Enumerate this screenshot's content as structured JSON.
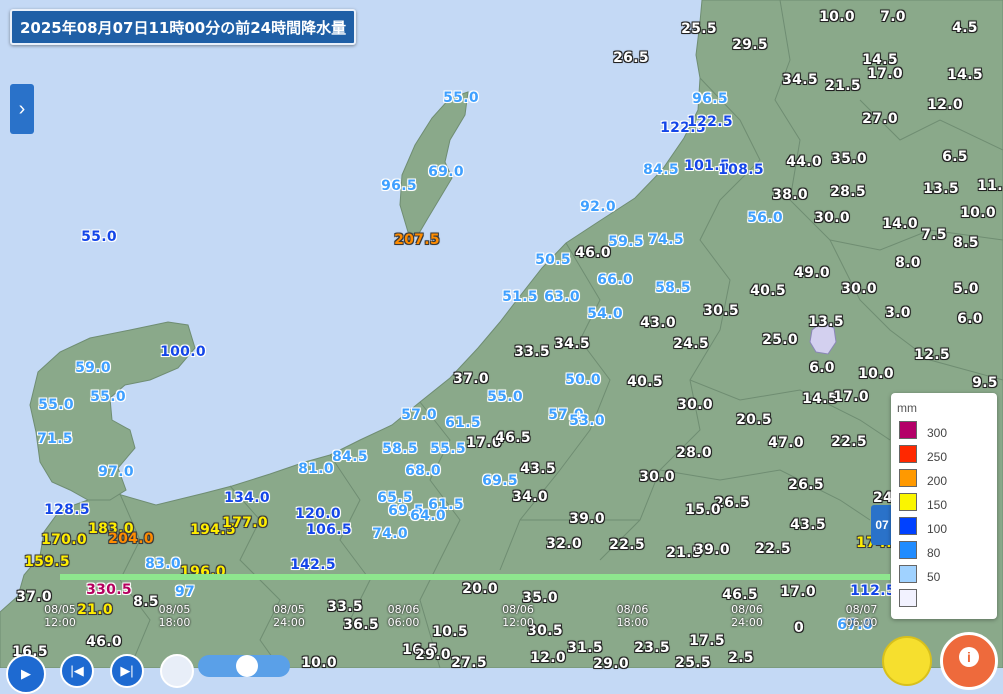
{
  "title": "2025年08月07日11時00分の前24時間降水量",
  "colors": {
    "sea": "#c4d9f5",
    "land": "#8aa98a",
    "border": "#6f8d72",
    "lake": "#d3d0ef",
    "timeline": "#8ee68e"
  },
  "style_colors": {
    "white": "#ffffff",
    "light_blue": "#3fa0ff",
    "blue": "#1446e8",
    "yellow": "#ffee00",
    "orange": "#ff8c00",
    "magenta": "#b5005e"
  },
  "icons": {
    "side_toggle": "chevron-right-icon",
    "help": "help-person-icon",
    "info": "info-book-icon"
  },
  "legend": {
    "unit": "mm",
    "items": [
      {
        "label": "300",
        "color": "#b40068"
      },
      {
        "label": "250",
        "color": "#ff2800"
      },
      {
        "label": "200",
        "color": "#ff9900"
      },
      {
        "label": "150",
        "color": "#faf500"
      },
      {
        "label": "100",
        "color": "#0041ff"
      },
      {
        "label": "80",
        "color": "#218cff"
      },
      {
        "label": "50",
        "color": "#a0d2ff"
      },
      {
        "label": "",
        "color": "#f2f2ff"
      }
    ]
  },
  "timeline": {
    "ticks": [
      {
        "date": "08/05",
        "time": "12:00"
      },
      {
        "date": "08/05",
        "time": "18:00"
      },
      {
        "date": "08/05",
        "time": "24:00"
      },
      {
        "date": "08/06",
        "time": "06:00"
      },
      {
        "date": "08/06",
        "time": "12:00"
      },
      {
        "date": "08/06",
        "time": "18:00"
      },
      {
        "date": "08/06",
        "time": "24:00"
      },
      {
        "date": "08/07",
        "time": "06:00"
      }
    ],
    "current_label": "07"
  },
  "stations": [
    {
      "v": "10.0",
      "s": "white"
    },
    {
      "v": "7.0",
      "s": "white"
    },
    {
      "v": "4.5",
      "s": "white"
    },
    {
      "v": "25.5",
      "s": "white"
    },
    {
      "v": "29.5",
      "s": "white"
    },
    {
      "v": "26.5",
      "s": "white"
    },
    {
      "v": "14.5",
      "s": "white"
    },
    {
      "v": "17.0",
      "s": "white"
    },
    {
      "v": "14.5",
      "s": "white"
    },
    {
      "v": "34.5",
      "s": "white"
    },
    {
      "v": "21.5",
      "s": "white"
    },
    {
      "v": "12.0",
      "s": "white"
    },
    {
      "v": "55.0",
      "s": "light_blue"
    },
    {
      "v": "96.5",
      "s": "light_blue"
    },
    {
      "v": "122.5",
      "s": "blue"
    },
    {
      "v": "122.5",
      "s": "blue"
    },
    {
      "v": "27.0",
      "s": "white"
    },
    {
      "v": "69.0",
      "s": "light_blue"
    },
    {
      "v": "96.5",
      "s": "light_blue"
    },
    {
      "v": "84.5",
      "s": "light_blue"
    },
    {
      "v": "101.5",
      "s": "blue"
    },
    {
      "v": "108.5",
      "s": "blue"
    },
    {
      "v": "44.0",
      "s": "white"
    },
    {
      "v": "35.0",
      "s": "white"
    },
    {
      "v": "6.5",
      "s": "white"
    },
    {
      "v": "38.0",
      "s": "white"
    },
    {
      "v": "28.5",
      "s": "white"
    },
    {
      "v": "13.5",
      "s": "white"
    },
    {
      "v": "92.0",
      "s": "light_blue"
    },
    {
      "v": "10.0",
      "s": "white"
    },
    {
      "v": "55.0",
      "s": "blue"
    },
    {
      "v": "207.5",
      "s": "orange"
    },
    {
      "v": "56.0",
      "s": "light_blue"
    },
    {
      "v": "30.0",
      "s": "white"
    },
    {
      "v": "14.0",
      "s": "white"
    },
    {
      "v": "7.5",
      "s": "white"
    },
    {
      "v": "8.5",
      "s": "white"
    },
    {
      "v": "59.5",
      "s": "light_blue"
    },
    {
      "v": "74.5",
      "s": "light_blue"
    },
    {
      "v": "46.0",
      "s": "white"
    },
    {
      "v": "50.5",
      "s": "light_blue"
    },
    {
      "v": "49.0",
      "s": "white"
    },
    {
      "v": "8.0",
      "s": "white"
    },
    {
      "v": "66.0",
      "s": "light_blue"
    },
    {
      "v": "58.5",
      "s": "light_blue"
    },
    {
      "v": "40.5",
      "s": "white"
    },
    {
      "v": "30.0",
      "s": "white"
    },
    {
      "v": "5.0",
      "s": "white"
    },
    {
      "v": "51.5",
      "s": "light_blue"
    },
    {
      "v": "63.0",
      "s": "light_blue"
    },
    {
      "v": "54.0",
      "s": "light_blue"
    },
    {
      "v": "30.5",
      "s": "white"
    },
    {
      "v": "3.0",
      "s": "white"
    },
    {
      "v": "43.0",
      "s": "white"
    },
    {
      "v": "13.5",
      "s": "white"
    },
    {
      "v": "6.0",
      "s": "white"
    },
    {
      "v": "100.0",
      "s": "blue"
    },
    {
      "v": "33.5",
      "s": "white"
    },
    {
      "v": "34.5",
      "s": "white"
    },
    {
      "v": "24.5",
      "s": "white"
    },
    {
      "v": "25.0",
      "s": "white"
    },
    {
      "v": "12.5",
      "s": "white"
    },
    {
      "v": "59.0",
      "s": "light_blue"
    },
    {
      "v": "37.0",
      "s": "white"
    },
    {
      "v": "50.0",
      "s": "light_blue"
    },
    {
      "v": "40.5",
      "s": "white"
    },
    {
      "v": "6.0",
      "s": "white"
    },
    {
      "v": "10.0",
      "s": "white"
    },
    {
      "v": "9.5",
      "s": "white"
    },
    {
      "v": "55.0",
      "s": "light_blue"
    },
    {
      "v": "55.0",
      "s": "light_blue"
    },
    {
      "v": "55.0",
      "s": "light_blue"
    },
    {
      "v": "14.5",
      "s": "white"
    },
    {
      "v": "17.0",
      "s": "white"
    },
    {
      "v": "30.0",
      "s": "white"
    },
    {
      "v": "57.0",
      "s": "light_blue"
    },
    {
      "v": "61.5",
      "s": "light_blue"
    },
    {
      "v": "57.0",
      "s": "light_blue"
    },
    {
      "v": "53.0",
      "s": "light_blue"
    },
    {
      "v": "20.5",
      "s": "white"
    },
    {
      "v": "71.5",
      "s": "light_blue"
    },
    {
      "v": "58.5",
      "s": "light_blue"
    },
    {
      "v": "55.5",
      "s": "light_blue"
    },
    {
      "v": "17.0",
      "s": "white"
    },
    {
      "v": "46.5",
      "s": "white"
    },
    {
      "v": "47.0",
      "s": "white"
    },
    {
      "v": "22.5",
      "s": "white"
    },
    {
      "v": "84.5",
      "s": "light_blue"
    },
    {
      "v": "28.0",
      "s": "white"
    },
    {
      "v": "81.0",
      "s": "light_blue"
    },
    {
      "v": "68.0",
      "s": "light_blue"
    },
    {
      "v": "43.5",
      "s": "white"
    },
    {
      "v": "97.0",
      "s": "light_blue"
    },
    {
      "v": "69.5",
      "s": "light_blue"
    },
    {
      "v": "30.0",
      "s": "white"
    },
    {
      "v": "26.5",
      "s": "white"
    },
    {
      "v": "34.0",
      "s": "white"
    },
    {
      "v": "26.5",
      "s": "white"
    },
    {
      "v": "24",
      "s": "white"
    },
    {
      "v": "134.0",
      "s": "blue"
    },
    {
      "v": "128.5",
      "s": "blue"
    },
    {
      "v": "65.5",
      "s": "light_blue"
    },
    {
      "v": "61.5",
      "s": "light_blue"
    },
    {
      "v": "15.0",
      "s": "white"
    },
    {
      "v": "194.5",
      "s": "yellow"
    },
    {
      "v": "177.0",
      "s": "yellow"
    },
    {
      "v": "120.0",
      "s": "blue"
    },
    {
      "v": "69.5",
      "s": "light_blue"
    },
    {
      "v": "64.0",
      "s": "light_blue"
    },
    {
      "v": "39.0",
      "s": "white"
    },
    {
      "v": "43.5",
      "s": "white"
    },
    {
      "v": "183.0",
      "s": "yellow"
    },
    {
      "v": "170.0",
      "s": "yellow"
    },
    {
      "v": "204.0",
      "s": "orange"
    },
    {
      "v": "106.5",
      "s": "blue"
    },
    {
      "v": "74.0",
      "s": "light_blue"
    },
    {
      "v": "32.0",
      "s": "white"
    },
    {
      "v": "22.5",
      "s": "white"
    },
    {
      "v": "21.5",
      "s": "white"
    },
    {
      "v": "39.0",
      "s": "white"
    },
    {
      "v": "22.5",
      "s": "white"
    },
    {
      "v": "174.0",
      "s": "yellow"
    },
    {
      "v": "159.5",
      "s": "yellow"
    },
    {
      "v": "83.0",
      "s": "light_blue"
    },
    {
      "v": "142.5",
      "s": "blue"
    },
    {
      "v": "196.0",
      "s": "yellow"
    },
    {
      "v": "330.5",
      "s": "magenta"
    },
    {
      "v": "37.0",
      "s": "white"
    },
    {
      "v": "33.5",
      "s": "white"
    },
    {
      "v": "36.5",
      "s": "white"
    },
    {
      "v": "20.0",
      "s": "white"
    },
    {
      "v": "35.0",
      "s": "white"
    },
    {
      "v": "46.5",
      "s": "white"
    },
    {
      "v": "17.0",
      "s": "white"
    },
    {
      "v": "112.5",
      "s": "blue"
    },
    {
      "v": "97",
      "s": "light_blue"
    },
    {
      "v": "8.5",
      "s": "white"
    },
    {
      "v": "16.5",
      "s": "white"
    },
    {
      "v": "10.5",
      "s": "white"
    },
    {
      "v": "30.5",
      "s": "white"
    },
    {
      "v": "0",
      "s": "white"
    },
    {
      "v": "67.0",
      "s": "light_blue"
    },
    {
      "v": "46.0",
      "s": "white"
    },
    {
      "v": "16.5",
      "s": "white"
    },
    {
      "v": "31.5",
      "s": "white"
    },
    {
      "v": "23.5",
      "s": "white"
    },
    {
      "v": "17.5",
      "s": "white"
    },
    {
      "v": "10.0",
      "s": "white"
    },
    {
      "v": "29.0",
      "s": "white"
    },
    {
      "v": "12.0",
      "s": "white"
    },
    {
      "v": "27.5",
      "s": "white"
    },
    {
      "v": "29.0",
      "s": "white"
    },
    {
      "v": "25.5",
      "s": "white"
    },
    {
      "v": "2.5",
      "s": "white"
    },
    {
      "v": "11.",
      "s": "white"
    },
    {
      "v": "21.0",
      "s": "yellow"
    }
  ]
}
